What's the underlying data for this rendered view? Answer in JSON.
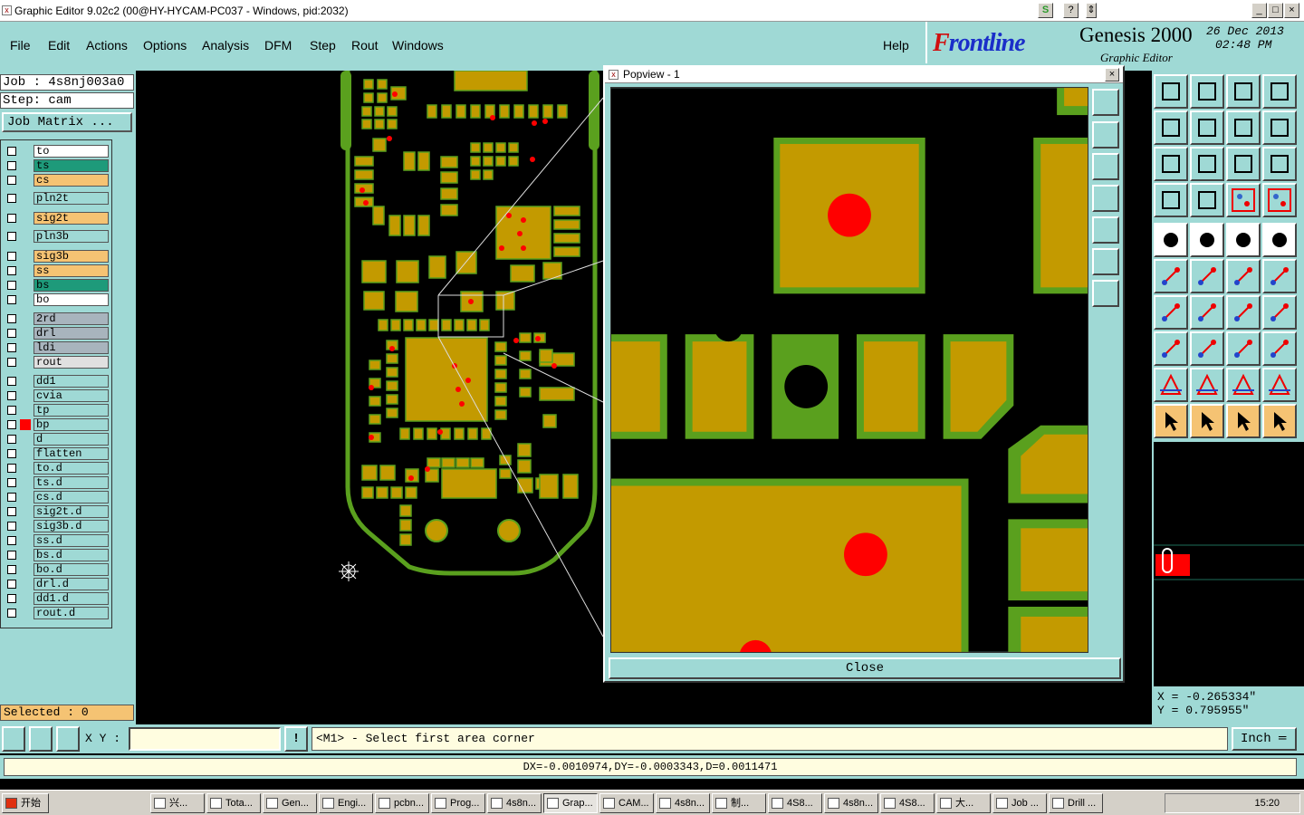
{
  "window": {
    "title": "Graphic Editor 9.02c2 (00@HY-HYCAM-PC037 - Windows, pid:2032)",
    "btn_help": "?",
    "btn_min": "_",
    "btn_max": "□",
    "btn_close": "×"
  },
  "menu": {
    "file": "File",
    "edit": "Edit",
    "actions": "Actions",
    "options": "Options",
    "analysis": "Analysis",
    "dfm": "DFM",
    "step": "Step",
    "rout": "Rout",
    "windows": "Windows",
    "help": "Help"
  },
  "brand": {
    "logo_prefix": "F",
    "logo_rest": "rontline",
    "product": "Genesis 2000",
    "subtitle": "Graphic Editor",
    "date": "26 Dec 2013",
    "time": "02:48 PM"
  },
  "job": {
    "job_line": "Job : 4s8nj003a0",
    "step_line": "Step: cam",
    "matrix_button": "Job Matrix ...",
    "selected": "Selected : 0"
  },
  "layers": [
    {
      "name": "to",
      "color": "#ffffff"
    },
    {
      "name": "ts",
      "color": "#1e9a7a"
    },
    {
      "name": "cs",
      "color": "#f5c373"
    },
    {
      "name": "pln2t",
      "color": "#9fd9d5"
    },
    {
      "name": "sig2t",
      "color": "#f5c373"
    },
    {
      "name": "pln3b",
      "color": "#9fd9d5"
    },
    {
      "name": "sig3b",
      "color": "#f5c373"
    },
    {
      "name": "ss",
      "color": "#f5c373"
    },
    {
      "name": "bs",
      "color": "#1e9a7a"
    },
    {
      "name": "bo",
      "color": "#ffffff"
    },
    {
      "name": "2rd",
      "color": "#a8b4bd"
    },
    {
      "name": "drl",
      "color": "#a8b4bd"
    },
    {
      "name": "ldi",
      "color": "#a8b4bd"
    },
    {
      "name": "rout",
      "color": "#e0e0e0"
    },
    {
      "name": "dd1",
      "color": "#9fd9d5"
    },
    {
      "name": "cvia",
      "color": "#9fd9d5"
    },
    {
      "name": "tp",
      "color": "#9fd9d5"
    },
    {
      "name": "bp",
      "color": "#9fd9d5"
    },
    {
      "name": "d",
      "color": "#9fd9d5"
    },
    {
      "name": "flatten",
      "color": "#9fd9d5"
    },
    {
      "name": "to.d",
      "color": "#9fd9d5"
    },
    {
      "name": "ts.d",
      "color": "#9fd9d5"
    },
    {
      "name": "cs.d",
      "color": "#9fd9d5"
    },
    {
      "name": "sig2t.d",
      "color": "#9fd9d5"
    },
    {
      "name": "sig3b.d",
      "color": "#9fd9d5"
    },
    {
      "name": "ss.d",
      "color": "#9fd9d5"
    },
    {
      "name": "bs.d",
      "color": "#9fd9d5"
    },
    {
      "name": "bo.d",
      "color": "#9fd9d5"
    },
    {
      "name": "drl.d",
      "color": "#9fd9d5"
    },
    {
      "name": "dd1.d",
      "color": "#9fd9d5"
    },
    {
      "name": "rout.d",
      "color": "#9fd9d5"
    }
  ],
  "popview": {
    "title": "Popview - 1",
    "close_label": "Close"
  },
  "coords": {
    "x": "X = -0.265334\"",
    "y": "Y = 0.795955\""
  },
  "command": {
    "xy_label": "X Y :",
    "xy_value": "",
    "message": "<M1> - Select first area corner",
    "unit": "Inch",
    "status": "DX=-0.0010974,DY=-0.0003343,D=0.0011471"
  },
  "taskbar": {
    "start": "开始",
    "clock": "15:20",
    "tasks": [
      "兴...",
      "Tota...",
      "Gen...",
      "Engi...",
      "pcbn...",
      "Prog...",
      "4s8n...",
      "Grap...",
      "CAM...",
      "4s8n...",
      "制...",
      "4S8...",
      "4s8n...",
      "4S8...",
      "大...",
      "Job ...",
      "Drill ..."
    ]
  },
  "colors": {
    "panel": "#9fd9d5",
    "copper": "#c39a00",
    "mask": "#5aa01e",
    "drill": "#ff0000",
    "highlight": "#f5c373"
  }
}
